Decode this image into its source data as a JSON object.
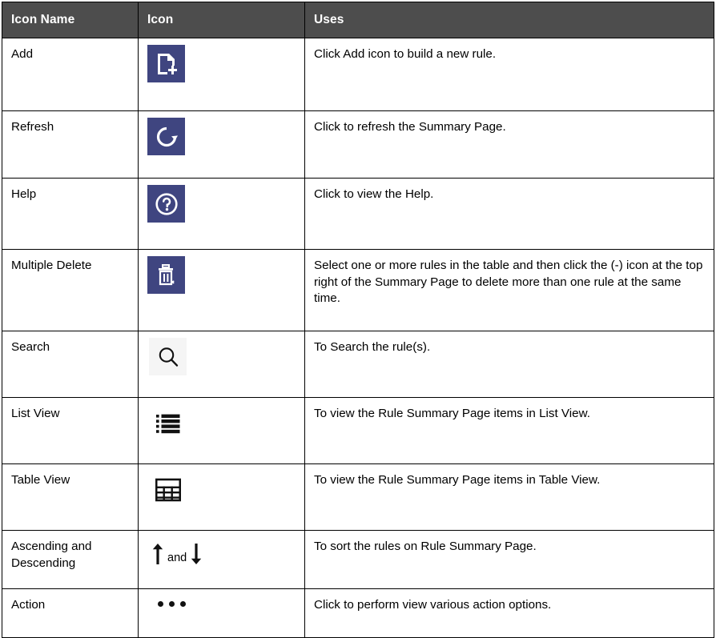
{
  "table": {
    "columns": [
      {
        "key": "icon_name",
        "label": "Icon Name"
      },
      {
        "key": "icon",
        "label": "Icon"
      },
      {
        "key": "uses",
        "label": "Uses"
      }
    ],
    "header_background": "#4d4d4d",
    "header_text_color": "#ffffff",
    "border_color": "#000000",
    "tile_color": "#3f4580",
    "rows": [
      {
        "icon_name": "Add",
        "icon": "add-document-icon",
        "icon_style": "tile",
        "uses": "Click Add icon to build a new rule."
      },
      {
        "icon_name": "Refresh",
        "icon": "refresh-icon",
        "icon_style": "tile",
        "uses": "Click to refresh the Summary Page."
      },
      {
        "icon_name": "Help",
        "icon": "help-question-icon",
        "icon_style": "tile",
        "uses": "Click to view the Help."
      },
      {
        "icon_name": "Multiple Delete",
        "icon": "trash-delete-icon",
        "icon_style": "tile",
        "uses": "Select one or more rules in the table and then click the (-) icon at the top right of the Summary Page to delete more than one rule at the same time."
      },
      {
        "icon_name": "Search",
        "icon": "search-icon",
        "icon_style": "plain-tinted",
        "uses": "To Search the rule(s)."
      },
      {
        "icon_name": "List View",
        "icon": "list-view-icon",
        "icon_style": "plain",
        "uses": "To view the Rule Summary Page items in List View."
      },
      {
        "icon_name": "Table View",
        "icon": "table-view-icon",
        "icon_style": "plain",
        "uses": "To view the Rule Summary Page items in Table View."
      },
      {
        "icon_name": "Ascending and Descending",
        "icon": "sort-arrows-icon",
        "icon_style": "sort",
        "conjunction": "and",
        "uses": "To sort the rules on Rule Summary Page."
      },
      {
        "icon_name": "Action",
        "icon": "more-actions-icon",
        "icon_style": "dots",
        "uses": "Click to perform view various action options."
      }
    ]
  }
}
